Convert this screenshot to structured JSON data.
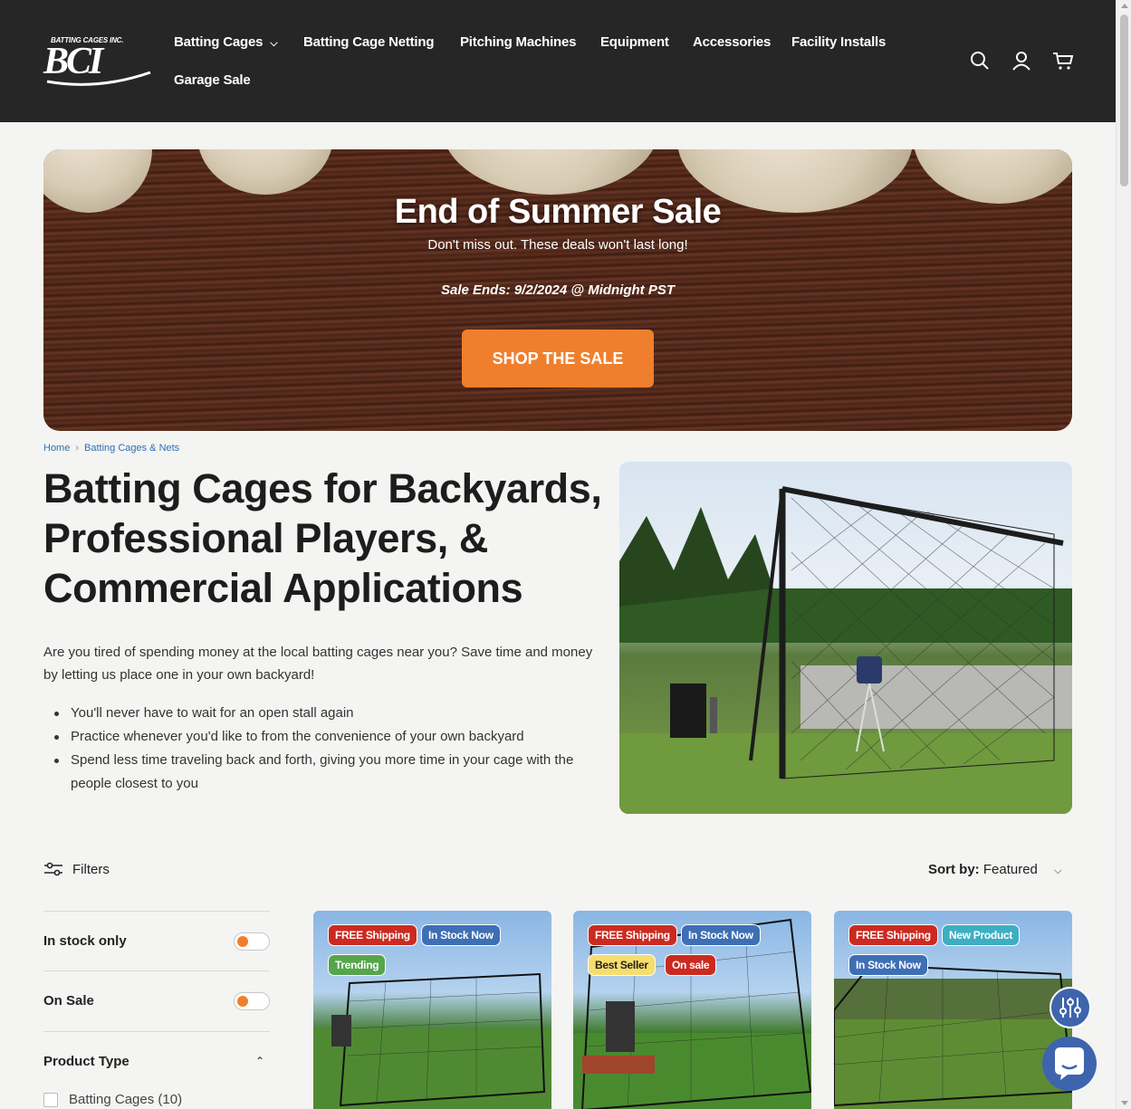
{
  "brand": {
    "tagline": "BATTING CAGES INC.",
    "mark": "BCI"
  },
  "nav": {
    "items": [
      {
        "label": "Batting Cages",
        "has_dropdown": true
      },
      {
        "label": "Batting Cage Netting"
      },
      {
        "label": "Pitching Machines"
      },
      {
        "label": "Equipment"
      },
      {
        "label": "Accessories"
      },
      {
        "label": "Facility Installs"
      },
      {
        "label": "Garage Sale"
      }
    ],
    "icons": [
      "search-icon",
      "account-icon",
      "cart-icon"
    ]
  },
  "hero": {
    "title": "End of Summer Sale",
    "subtitle": "Don't miss out. These deals won't last long!",
    "ends": "Sale Ends: 9/2/2024 @ Midnight PST",
    "cta": "SHOP THE SALE"
  },
  "breadcrumb": {
    "home": "Home",
    "current": "Batting Cages & Nets"
  },
  "page": {
    "title": "Batting Cages for Backyards, Professional Players, & Commercial Applications",
    "intro": "Are you tired of spending money at the local batting cages near you? Save time and money by letting us place one in your own backyard!",
    "bullets": [
      "You'll never have to wait for an open stall again",
      "Practice whenever you'd like to from the convenience of your own backyard",
      "Spend less time traveling back and forth, giving you more time in your cage with the people closest to you"
    ]
  },
  "toolbar": {
    "filters_label": "Filters",
    "sort_label": "Sort by:",
    "sort_value": "Featured"
  },
  "filters": {
    "in_stock_label": "In stock only",
    "on_sale_label": "On Sale",
    "product_type_label": "Product Type",
    "product_type_options": [
      {
        "label": "Batting Cages (10)",
        "checked": false
      }
    ]
  },
  "products": [
    {
      "badges": [
        {
          "text": "FREE Shipping",
          "color": "#cc2a20"
        },
        {
          "text": "In Stock Now",
          "color": "#3e6fb5"
        },
        {
          "text": "Trending",
          "color": "#55a54a"
        }
      ]
    },
    {
      "badges": [
        {
          "text": "FREE Shipping",
          "color": "#cc2a20"
        },
        {
          "text": "In Stock Now",
          "color": "#3e6fb5"
        },
        {
          "text": "Best Seller",
          "color": "#f6dd6e"
        },
        {
          "text": "On sale",
          "color": "#cc2a20"
        }
      ]
    },
    {
      "badges": [
        {
          "text": "FREE Shipping",
          "color": "#cc2a20"
        },
        {
          "text": "New Product",
          "color": "#3dafc2"
        },
        {
          "text": "In Stock Now",
          "color": "#3e6fb5"
        }
      ]
    }
  ],
  "colors": {
    "header_bg": "#262626",
    "accent": "#f07f2d",
    "link": "#2e6fb5",
    "fab": "#3d64ad"
  }
}
